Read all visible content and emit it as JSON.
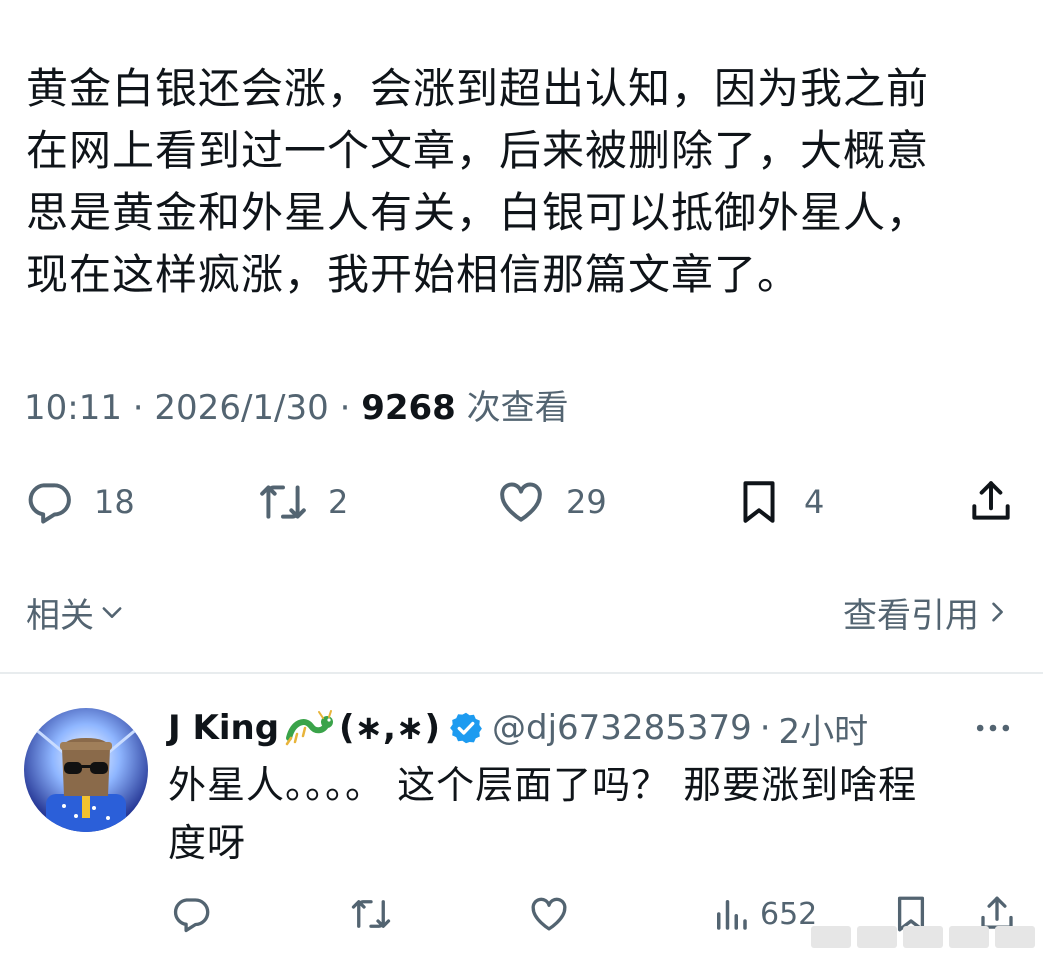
{
  "tweet": {
    "text": "黄金白银还会涨，会涨到超出认知，因为我之前\n在网上看到过一个文章，后来被删除了，大概意\n思是黄金和外星人有关，白银可以抵御外星人，\n现在这样疯涨，我开始相信那篇文章了。",
    "time": "10:11",
    "date": "2026/1/30",
    "separator": "·",
    "views_count": "9268",
    "views_label": "次查看"
  },
  "actions": {
    "reply_count": "18",
    "retweet_count": "2",
    "like_count": "29",
    "bookmark_count": "4"
  },
  "related": {
    "label": "相关",
    "quotes_label": "查看引用"
  },
  "reply": {
    "display_name": "J King",
    "name_suffix": "(∗,∗)",
    "handle": "@dj673285379",
    "separator": "·",
    "time": "2小时",
    "text": "外星人。。。。 这个层面了吗？ 那要涨到啥程\n度呀",
    "views_count": "652"
  },
  "colors": {
    "text": "#0f1419",
    "secondary": "#536471",
    "verified": "#1d9bf0",
    "divider": "#e8ecee"
  },
  "icons": [
    "reply-icon",
    "retweet-icon",
    "like-icon",
    "bookmark-icon",
    "share-icon",
    "chevron-down-icon",
    "chevron-right-icon",
    "verified-badge-icon",
    "dragon-emoji-icon",
    "more-icon",
    "views-icon"
  ]
}
